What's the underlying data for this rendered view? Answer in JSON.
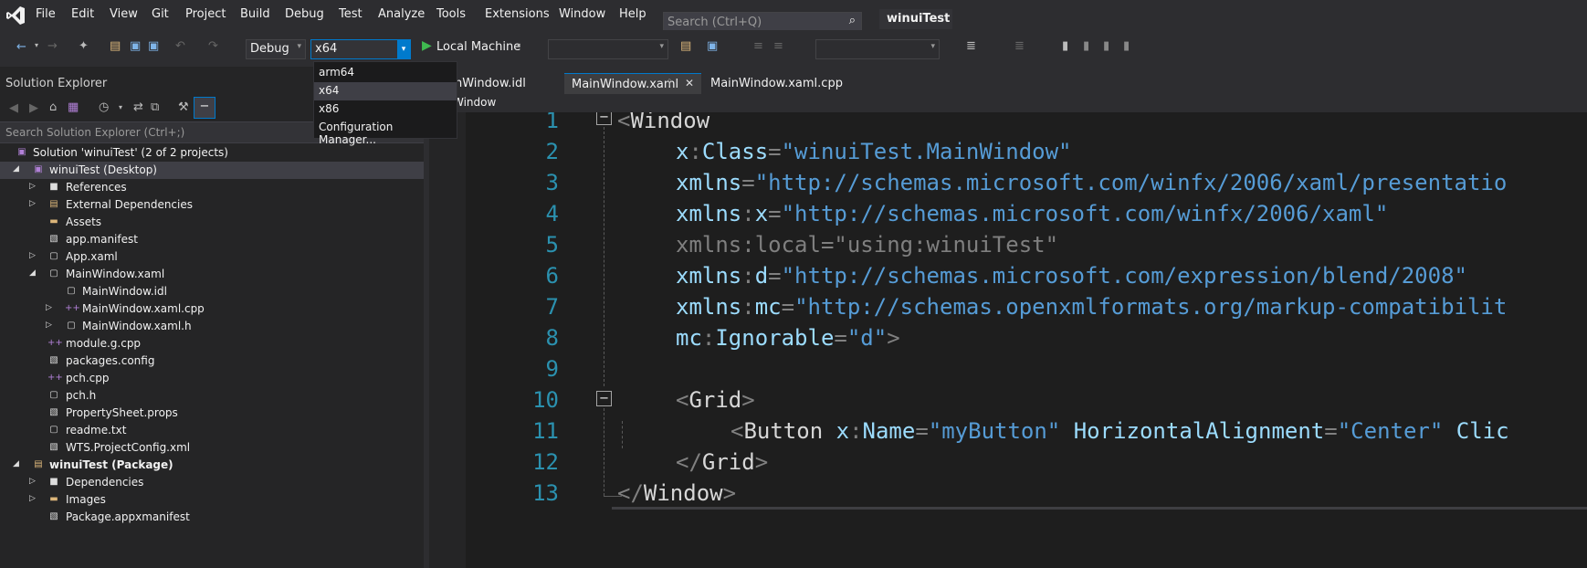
{
  "menu": {
    "items": [
      "File",
      "Edit",
      "View",
      "Git",
      "Project",
      "Build",
      "Debug",
      "Test",
      "Analyze",
      "Tools",
      "Extensions",
      "Window",
      "Help"
    ],
    "search_placeholder": "Search (Ctrl+Q)",
    "solution_name": "winuiTest"
  },
  "toolbar": {
    "configuration": "Debug",
    "platform": "x64",
    "run_target": "Local Machine"
  },
  "platform_dropdown": {
    "options": [
      "arm64",
      "x64",
      "x86",
      "Configuration Manager..."
    ],
    "selected": "x64"
  },
  "solution_explorer": {
    "title": "Solution Explorer",
    "search_placeholder": "Search Solution Explorer (Ctrl+;)",
    "items": [
      {
        "label": "Solution 'winuiTest' (2 of 2 projects)"
      },
      {
        "label": "winuiTest (Desktop)"
      },
      {
        "label": "References"
      },
      {
        "label": "External Dependencies"
      },
      {
        "label": "Assets"
      },
      {
        "label": "app.manifest"
      },
      {
        "label": "App.xaml"
      },
      {
        "label": "MainWindow.xaml"
      },
      {
        "label": "MainWindow.idl"
      },
      {
        "label": "MainWindow.xaml.cpp"
      },
      {
        "label": "MainWindow.xaml.h"
      },
      {
        "label": "module.g.cpp"
      },
      {
        "label": "packages.config"
      },
      {
        "label": "pch.cpp"
      },
      {
        "label": "pch.h"
      },
      {
        "label": "PropertySheet.props"
      },
      {
        "label": "readme.txt"
      },
      {
        "label": "WTS.ProjectConfig.xml"
      },
      {
        "label": "winuiTest (Package)"
      },
      {
        "label": "Dependencies"
      },
      {
        "label": "Images"
      },
      {
        "label": "Package.appxmanifest"
      }
    ]
  },
  "tabs": [
    "nWindow.idl",
    "MainWindow.xaml",
    "MainWindow.xaml.cpp"
  ],
  "navbar": {
    "scope": "Window"
  },
  "editor": {
    "line_numbers": [
      "1",
      "2",
      "3",
      "4",
      "5",
      "6",
      "7",
      "8",
      "9",
      "10",
      "11",
      "12",
      "13"
    ],
    "lines": {
      "l1": [
        "<",
        "Window"
      ],
      "l2": [
        "x",
        ":",
        "Class",
        "=",
        "\"winuiTest.MainWindow\""
      ],
      "l3": [
        "xmlns",
        "=",
        "\"http://schemas.microsoft.com/winfx/2006/xaml/presentatio"
      ],
      "l4": [
        "xmlns",
        ":",
        "x",
        "=",
        "\"http://schemas.microsoft.com/winfx/2006/xaml\""
      ],
      "l5": [
        "xmlns",
        ":",
        "local",
        "=",
        "\"using:winuiTest\""
      ],
      "l6": [
        "xmlns",
        ":",
        "d",
        "=",
        "\"http://schemas.microsoft.com/expression/blend/2008\""
      ],
      "l7": [
        "xmlns",
        ":",
        "mc",
        "=",
        "\"http://schemas.openxmlformats.org/markup-compatibilit"
      ],
      "l8": [
        "mc",
        ":",
        "Ignorable",
        "=",
        "\"d\"",
        ">"
      ],
      "l10": [
        "<",
        "Grid",
        ">"
      ],
      "l11": [
        "<",
        "Button",
        "x",
        ":",
        "Name",
        "=",
        "\"myButton\"",
        "HorizontalAlignment",
        "=",
        "\"Center\"",
        "Clic"
      ],
      "l12": [
        "</",
        "Grid",
        ">"
      ],
      "l13": [
        "</",
        "Window",
        ">"
      ]
    }
  }
}
